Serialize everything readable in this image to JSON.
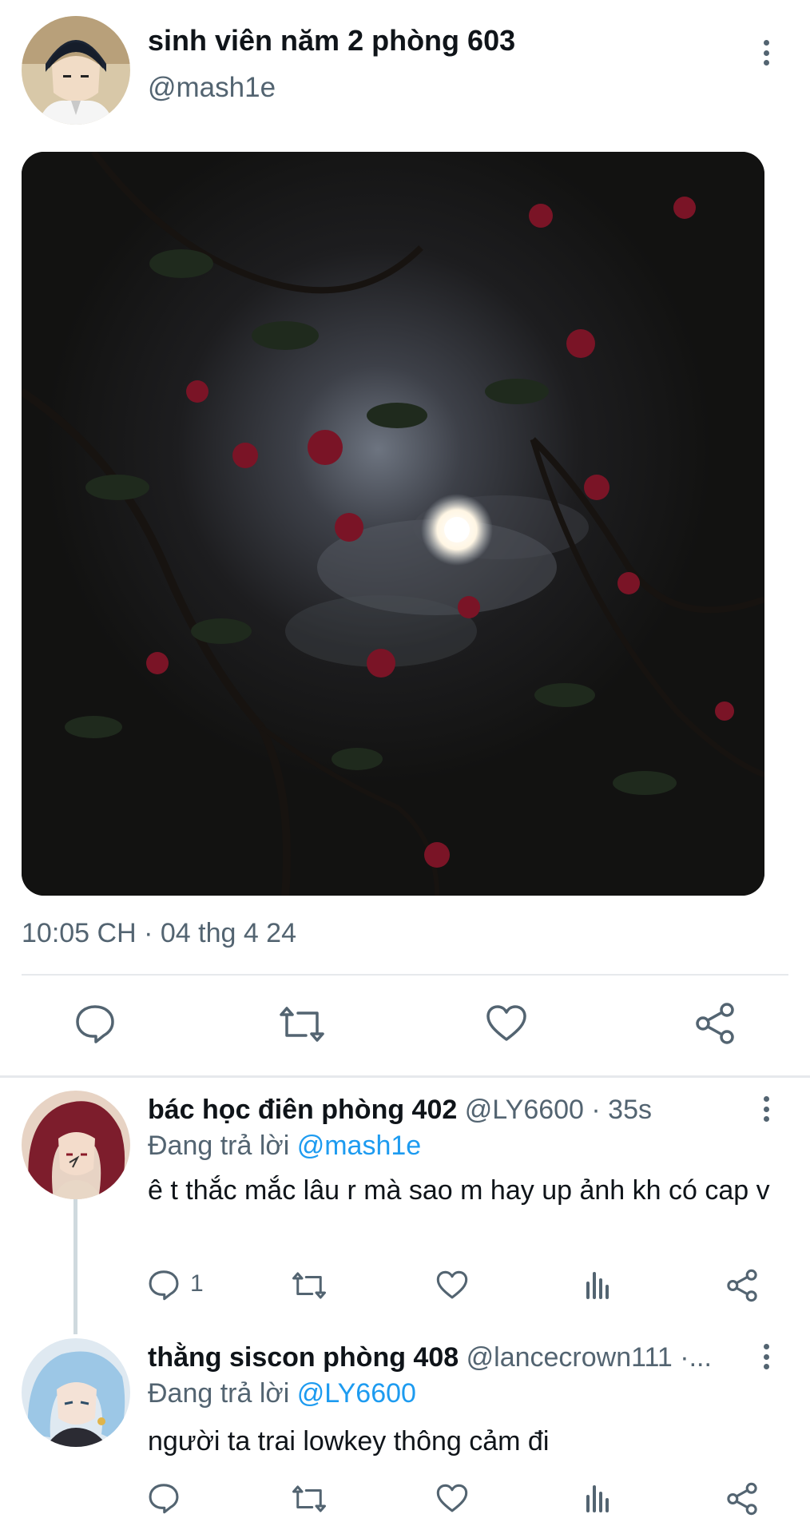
{
  "tweet": {
    "author_name": "sinh viên năm 2 phòng 603",
    "author_handle": "@mash1e",
    "timestamp": "10:05 CH · 04 thg 4 24",
    "photo_alt": "Full moon behind bougainvillea flowers at night",
    "actions": [
      "reply-icon",
      "retweet-icon",
      "like-icon",
      "share-icon"
    ]
  },
  "replies": [
    {
      "author_name": "bác học điên phòng 402",
      "author_handle": "@LY6600",
      "time": "· 35s",
      "replying_prefix": "Đang trả lời",
      "replying_to": "@mash1e",
      "text": "ê t thắc mắc lâu r mà sao m hay up ảnh kh có cap v",
      "reply_count": "1"
    },
    {
      "author_name": "thằng siscon phòng 408",
      "author_handle": "@lancecrown111 ·...",
      "replying_prefix": "Đang trả lời",
      "replying_to": "@LY6600",
      "text": "người ta trai lowkey thông cảm đi"
    }
  ],
  "colors": {
    "text": "#0f1419",
    "muted": "#536471",
    "link": "#1d9bf0",
    "divider": "#e6e9ec"
  }
}
